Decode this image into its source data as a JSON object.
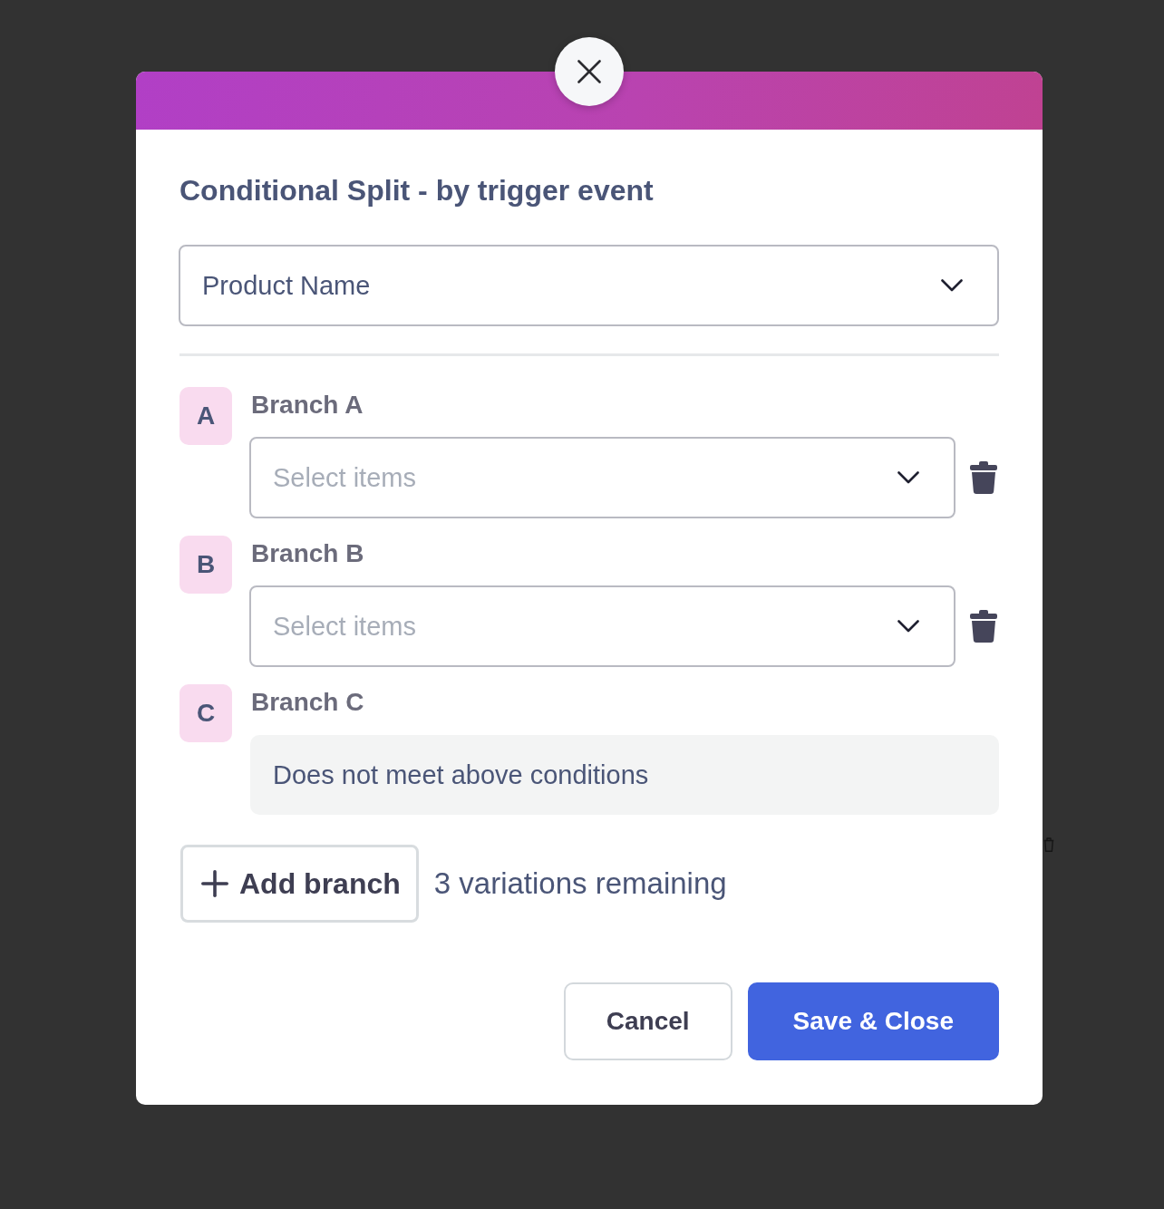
{
  "modal": {
    "title": "Conditional Split - by trigger event"
  },
  "trigger_select": {
    "value": "Product Name"
  },
  "branches": [
    {
      "badge": "A",
      "label": "Branch A",
      "kind": "select",
      "placeholder": "Select items"
    },
    {
      "badge": "B",
      "label": "Branch B",
      "kind": "select",
      "placeholder": "Select items"
    },
    {
      "badge": "C",
      "label": "Branch C",
      "kind": "fallback",
      "text": "Does not meet above conditions"
    }
  ],
  "add_branch": {
    "label": "Add branch"
  },
  "remaining": "3 variations remaining",
  "buttons": [
    {
      "label": "Cancel",
      "kind": "secondary"
    },
    {
      "label": "Save & Close",
      "kind": "primary"
    }
  ]
}
